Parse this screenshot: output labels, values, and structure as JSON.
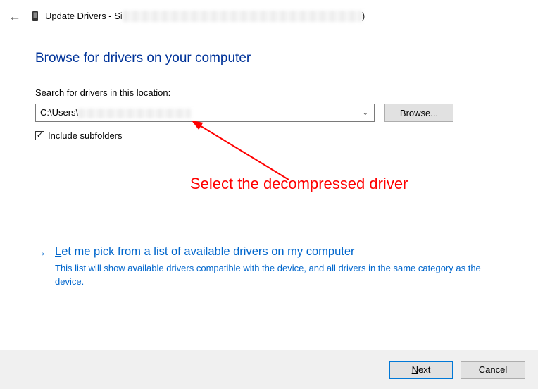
{
  "header": {
    "title_prefix": "Update Drivers - Si",
    "title_suffix": ")"
  },
  "page": {
    "heading": "Browse for drivers on your computer",
    "search_label": "Search for drivers in this location:",
    "path_value_prefix": "C:\\Users\\",
    "browse_label": "Browse...",
    "include_subfolders_label": "Include subfolders",
    "include_subfolders_checked": "☑"
  },
  "annotation": {
    "text": "Select the decompressed driver"
  },
  "pick": {
    "arrow": "→",
    "link_prefix": "L",
    "link_rest": "et me pick from a list of available drivers on my computer",
    "desc": "This list will show available drivers compatible with the device, and all drivers in the same category as the device."
  },
  "footer": {
    "next_accel": "N",
    "next_rest": "ext",
    "cancel_label": "Cancel"
  }
}
